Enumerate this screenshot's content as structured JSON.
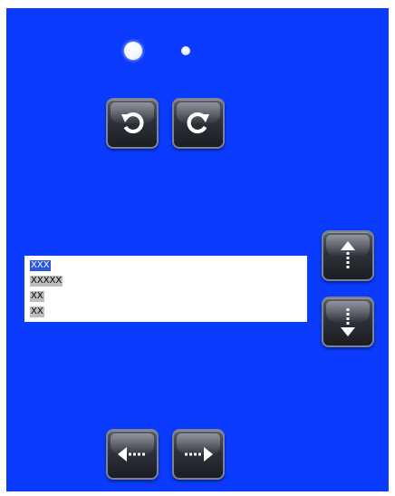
{
  "theme": {
    "panel_bg": "#0a3bff",
    "button_bg": "#2e3139",
    "selection_bg": "#2a56e8",
    "item_bg": "#bdbdbd"
  },
  "page_indicator": {
    "pages": 2,
    "current_page": 1
  },
  "buttons": {
    "rotate_left": {
      "icon": "rotate-ccw-icon"
    },
    "rotate_right": {
      "icon": "rotate-cw-icon"
    },
    "move_up": {
      "icon": "dotted-arrow-up-icon"
    },
    "move_down": {
      "icon": "dotted-arrow-down-icon"
    },
    "move_left": {
      "icon": "dotted-arrow-left-icon"
    },
    "move_right": {
      "icon": "dotted-arrow-right-icon"
    }
  },
  "list": {
    "items": [
      "XXX",
      "XXXXX",
      "XX",
      "XX"
    ],
    "selected_index": 0
  }
}
